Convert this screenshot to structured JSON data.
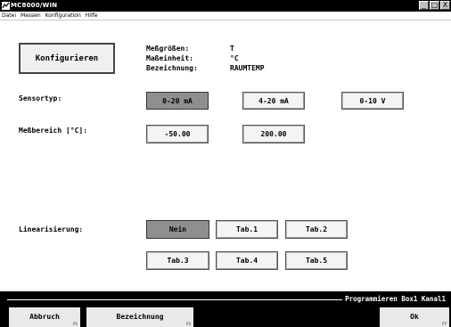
{
  "window": {
    "title": "MC8000/WIN",
    "controls": [
      "_",
      "□",
      "X"
    ]
  },
  "menu": [
    {
      "label": "Datei"
    },
    {
      "label": "Messen"
    },
    {
      "label": "Konfiguration"
    },
    {
      "label": "Hilfe"
    }
  ],
  "configure_button": "Konfigurieren",
  "info": {
    "messgroessen_label": "Meßgrößen:",
    "messgroessen_value": "T",
    "masseinheit_label": "Maßeinheit:",
    "masseinheit_value": "°C",
    "bezeichnung_label": "Bezeichnung:",
    "bezeichnung_value": "RAUMTEMP"
  },
  "sensortyp": {
    "label": "Sensortyp:",
    "options": [
      "0-20 mA",
      "4-20 mA",
      "0-10 V"
    ],
    "selected": "0-20 mA"
  },
  "messbereich": {
    "label": "Meßbereich [°C]:",
    "min": "-50.00",
    "max": "200.00"
  },
  "linearisierung": {
    "label": "Linearisierung:",
    "options": [
      "Nein",
      "Tab.1",
      "Tab.2",
      "Tab.3",
      "Tab.4",
      "Tab.5"
    ],
    "selected": "Nein"
  },
  "status": "Programmieren Box1 Kanal1",
  "function_keys": [
    {
      "label": "Abbruch",
      "key": "F1"
    },
    {
      "label": "Bezeichnung",
      "key": "F2"
    },
    {
      "label": "Ok",
      "key": "F7"
    }
  ],
  "colors": {
    "titlebar": "#000000",
    "selected_button": "#8f8f8f",
    "button": "#f4f4f4",
    "bottombar": "#000000"
  }
}
